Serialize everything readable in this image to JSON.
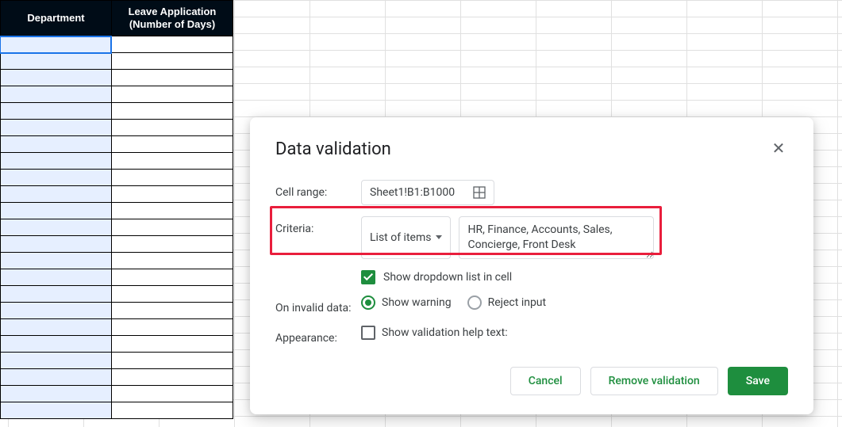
{
  "sheet": {
    "headers": {
      "col_a": "Department",
      "col_b": "Leave Application\n(Number of Days)"
    },
    "visible_data_rows": 23
  },
  "dialog": {
    "title": "Data validation",
    "cell_range": {
      "label": "Cell range:",
      "value": "Sheet1!B1:B1000"
    },
    "criteria": {
      "label": "Criteria:",
      "type_label": "List of items",
      "items_value": "HR, Finance, Accounts, Sales, Concierge, Front Desk"
    },
    "show_dropdown": {
      "label": "Show dropdown list in cell",
      "checked": true
    },
    "on_invalid": {
      "label": "On invalid data:",
      "options": {
        "show_warning": "Show warning",
        "reject_input": "Reject input"
      },
      "selected": "show_warning"
    },
    "appearance": {
      "label": "Appearance:",
      "help_text_label": "Show validation help text:",
      "checked": false
    },
    "buttons": {
      "cancel": "Cancel",
      "remove": "Remove validation",
      "save": "Save"
    }
  }
}
